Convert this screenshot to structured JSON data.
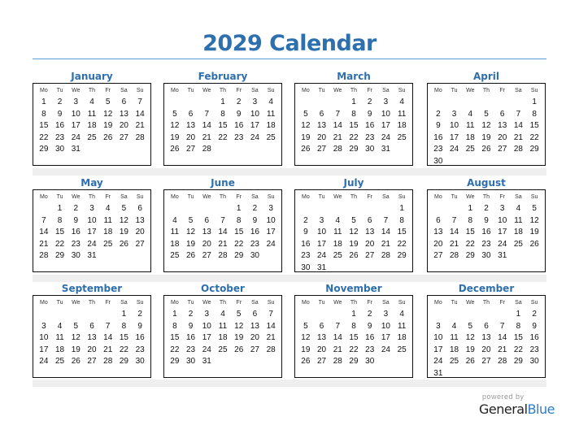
{
  "title": "2029 Calendar",
  "weekday_headers": [
    "Mo",
    "Tu",
    "We",
    "Th",
    "Fr",
    "Sa",
    "Su"
  ],
  "months": [
    {
      "name": "January",
      "offset": 0,
      "days": 31
    },
    {
      "name": "February",
      "offset": 3,
      "days": 28
    },
    {
      "name": "March",
      "offset": 3,
      "days": 31
    },
    {
      "name": "April",
      "offset": 6,
      "days": 30
    },
    {
      "name": "May",
      "offset": 1,
      "days": 31
    },
    {
      "name": "June",
      "offset": 4,
      "days": 30
    },
    {
      "name": "July",
      "offset": 6,
      "days": 31
    },
    {
      "name": "August",
      "offset": 2,
      "days": 31
    },
    {
      "name": "September",
      "offset": 5,
      "days": 30
    },
    {
      "name": "October",
      "offset": 0,
      "days": 31
    },
    {
      "name": "November",
      "offset": 3,
      "days": 30
    },
    {
      "name": "December",
      "offset": 5,
      "days": 31
    }
  ],
  "footer": {
    "powered_by": "powered by",
    "brand_part1": "General",
    "brand_part2": "Blue"
  }
}
